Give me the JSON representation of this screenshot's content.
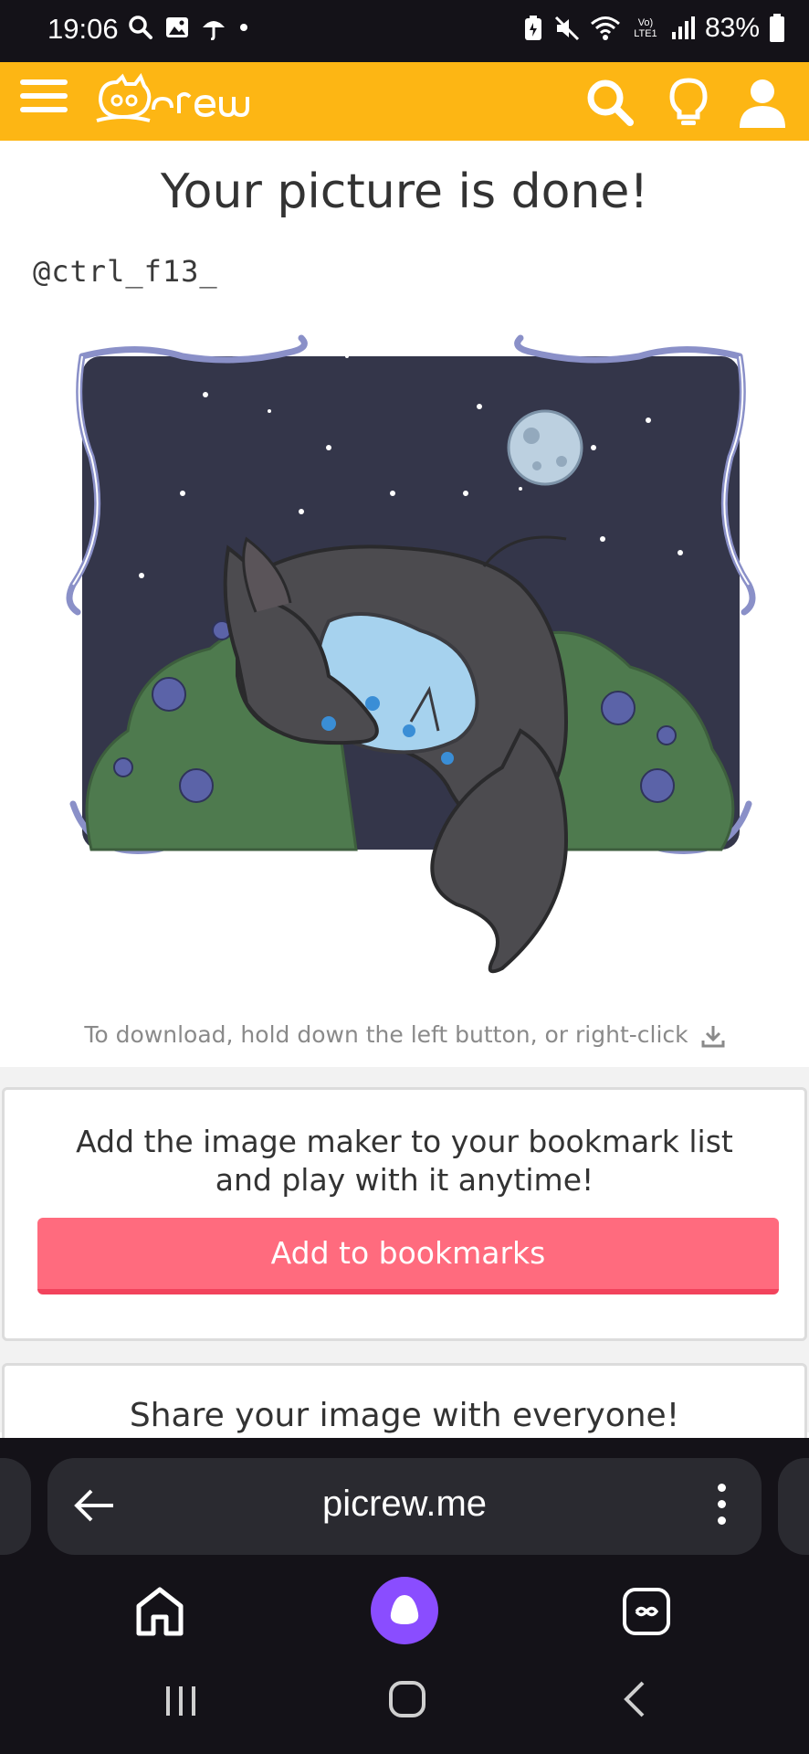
{
  "status_bar": {
    "time": "19:06",
    "battery_percent": "83%",
    "left_icons": [
      "search-icon",
      "image-icon",
      "umbrella-icon",
      "dot-icon"
    ],
    "right_icons": [
      "battery-saver-icon",
      "mute-icon",
      "wifi-icon",
      "volte-icon",
      "signal-icon",
      "battery-icon"
    ],
    "volte_label": "Vo) LTE1"
  },
  "header": {
    "logo_text": "Picrew",
    "brand_color": "#fdb614",
    "icons": [
      "menu-icon",
      "search-icon",
      "lightbulb-icon",
      "user-icon"
    ]
  },
  "main": {
    "title": "Your picture is done!",
    "signature": "@ctrl_f13_",
    "download_hint": "To download, hold down the left button, or right-click"
  },
  "bookmark_card": {
    "text": "Add the image maker to your bookmark list and play with it anytime!",
    "button_label": "Add to bookmarks",
    "button_color": "#ff6b7e"
  },
  "share_card": {
    "text": "Share your image with everyone!"
  },
  "browser": {
    "url": "picrew.me",
    "bottom_icons": [
      "home-icon",
      "alice-assistant-icon",
      "tabs-icon"
    ],
    "system_nav": [
      "recents-icon",
      "home-circle-icon",
      "back-chevron-icon"
    ]
  }
}
